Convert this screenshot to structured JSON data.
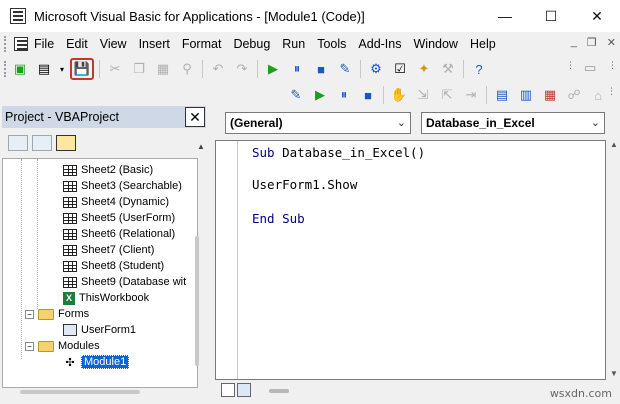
{
  "window": {
    "title": "Microsoft Visual Basic for Applications - [Module1 (Code)]",
    "minimize_glyph": "—",
    "maximize_glyph": "☐",
    "close_glyph": "✕"
  },
  "menu": {
    "items": [
      {
        "label": "File"
      },
      {
        "label": "Edit"
      },
      {
        "label": "View"
      },
      {
        "label": "Insert"
      },
      {
        "label": "Format"
      },
      {
        "label": "Debug"
      },
      {
        "label": "Run"
      },
      {
        "label": "Tools"
      },
      {
        "label": "Add-Ins"
      },
      {
        "label": "Window"
      },
      {
        "label": "Help"
      }
    ],
    "mdi_minimize": "_",
    "mdi_restore": "❐",
    "mdi_close": "✕"
  },
  "toolbar": {
    "icons": [
      "view-excel-icon",
      "insert-userform-icon",
      "save-icon",
      "cut-icon",
      "copy-icon",
      "paste-icon",
      "find-icon",
      "undo-icon",
      "redo-icon",
      "run-icon",
      "break-icon",
      "reset-icon",
      "design-mode-icon",
      "project-explorer-icon",
      "properties-icon",
      "object-browser-icon",
      "toolbox-icon",
      "help-icon"
    ],
    "highlight_color": "#c0392b"
  },
  "project": {
    "title": "Project - VBAProject",
    "close_glyph": "✕",
    "tree": [
      {
        "label": "Sheet2 (Basic)",
        "type": "sheet"
      },
      {
        "label": "Sheet3 (Searchable)",
        "type": "sheet"
      },
      {
        "label": "Sheet4 (Dynamic)",
        "type": "sheet"
      },
      {
        "label": "Sheet5 (UserForm)",
        "type": "sheet"
      },
      {
        "label": "Sheet6 (Relational)",
        "type": "sheet"
      },
      {
        "label": "Sheet7 (Client)",
        "type": "sheet"
      },
      {
        "label": "Sheet8 (Student)",
        "type": "sheet"
      },
      {
        "label": "Sheet9 (Database wit",
        "type": "sheet"
      },
      {
        "label": "ThisWorkbook",
        "type": "workbook"
      },
      {
        "label": "Forms",
        "type": "folder"
      },
      {
        "label": "UserForm1",
        "type": "form"
      },
      {
        "label": "Modules",
        "type": "folder"
      },
      {
        "label": "Module1",
        "type": "module",
        "selected": true
      }
    ],
    "selection_color": "#0a64d8"
  },
  "code": {
    "object_combo": "(General)",
    "procedure_combo": "Database_in_Excel",
    "lines": [
      {
        "keyword": "Sub",
        "rest": " Database_in_Excel()"
      },
      {
        "keyword": "",
        "rest": "UserForm1.Show"
      },
      {
        "keyword": "End Sub",
        "rest": ""
      }
    ],
    "keyword_color": "#00007f"
  },
  "watermark": "wsxdn.com"
}
